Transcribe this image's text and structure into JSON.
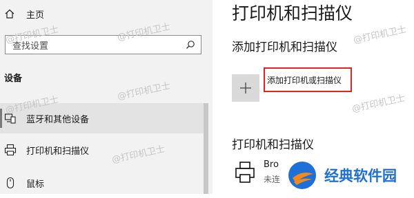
{
  "sidebar": {
    "home_label": "主页",
    "search_placeholder": "查找设置",
    "section_title": "设备",
    "items": [
      {
        "label": "蓝牙和其他设备",
        "icon": "bluetooth-devices-icon",
        "selected": true
      },
      {
        "label": "打印机和扫描仪",
        "icon": "printer-icon",
        "selected": false
      },
      {
        "label": "鼠标",
        "icon": "mouse-icon",
        "selected": false
      }
    ]
  },
  "main": {
    "page_title": "打印机和扫描仪",
    "add_section_title": "添加打印机和扫描仪",
    "add_button_label": "添加打印机或扫描仪",
    "printers_section_title": "打印机和扫描仪",
    "printer_name_visible": "Bro",
    "printer_status_visible": "未连"
  },
  "watermark_text": "@打印机卫士",
  "brand": {
    "text": "经典软件园"
  },
  "colors": {
    "highlight_border": "#e0241b",
    "brand_blue": "#1e6fd6",
    "brand_orange": "#f08a1c"
  }
}
